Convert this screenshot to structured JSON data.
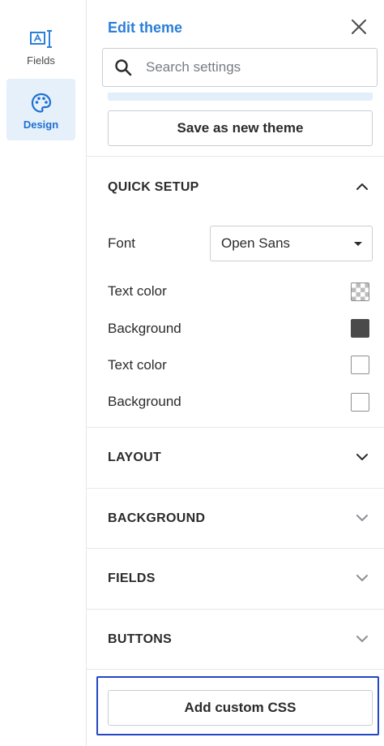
{
  "sidebar": {
    "items": [
      {
        "label": "Fields",
        "icon": "text-field-icon",
        "active": false
      },
      {
        "label": "Design",
        "icon": "palette-icon",
        "active": true
      }
    ]
  },
  "panel": {
    "title": "Edit theme",
    "search": {
      "placeholder": "Search settings",
      "value": ""
    },
    "save_theme_label": "Save as new theme",
    "quick_setup": {
      "title": "QUICK SETUP",
      "font_label": "Font",
      "font_value": "Open Sans",
      "colors": [
        {
          "label": "Text color",
          "swatch": "checker"
        },
        {
          "label": "Background",
          "swatch": "#4a4a4a"
        },
        {
          "label": "Text color",
          "swatch": "#ffffff"
        },
        {
          "label": "Background",
          "swatch": "#ffffff"
        }
      ]
    },
    "sections": [
      {
        "title": "LAYOUT"
      },
      {
        "title": "BACKGROUND"
      },
      {
        "title": "FIELDS"
      },
      {
        "title": "BUTTONS"
      }
    ],
    "add_css_label": "Add custom CSS"
  },
  "colors": {
    "accent": "#2b7fd8",
    "active_bg": "#e5f0fb",
    "highlight_border": "#2446c7"
  }
}
